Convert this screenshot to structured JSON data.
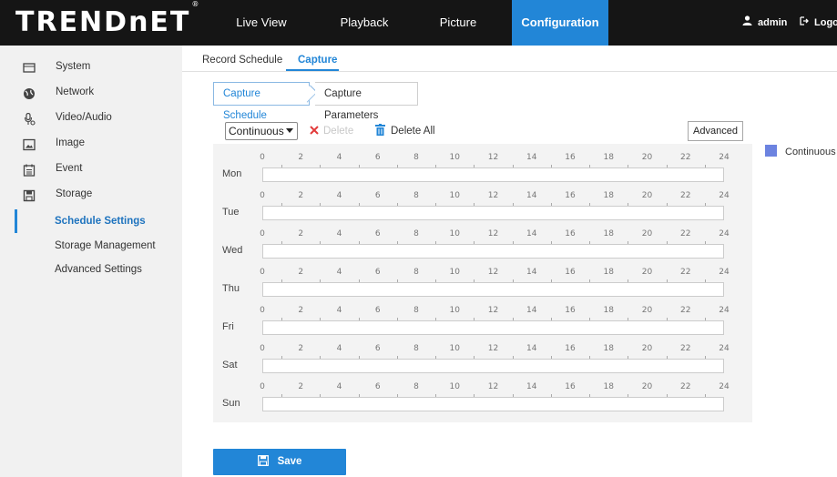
{
  "header": {
    "logo": "TRENDnET",
    "logo_mark": "®",
    "nav": [
      {
        "label": "Live View"
      },
      {
        "label": "Playback"
      },
      {
        "label": "Picture"
      },
      {
        "label": "Configuration",
        "active": true
      }
    ],
    "user_label": "admin",
    "logout_label": "Logout"
  },
  "sidebar": {
    "items": [
      {
        "label": "System",
        "icon": "monitor-icon"
      },
      {
        "label": "Network",
        "icon": "globe-icon"
      },
      {
        "label": "Video/Audio",
        "icon": "video-audio-icon"
      },
      {
        "label": "Image",
        "icon": "image-icon"
      },
      {
        "label": "Event",
        "icon": "calendar-icon"
      },
      {
        "label": "Storage",
        "icon": "storage-icon"
      }
    ],
    "sub_items": [
      {
        "label": "Schedule Settings",
        "active": true
      },
      {
        "label": "Storage Management"
      },
      {
        "label": "Advanced Settings"
      }
    ]
  },
  "tabs": [
    {
      "label": "Record Schedule"
    },
    {
      "label": "Capture",
      "active": true
    }
  ],
  "subtabs": [
    {
      "label": "Capture Schedule",
      "active": true
    },
    {
      "label": "Capture Parameters"
    }
  ],
  "toolbar": {
    "mode_select": "Continuous",
    "delete_label": "Delete",
    "delete_all_label": "Delete All",
    "advanced_label": "Advanced"
  },
  "schedule": {
    "hours": [
      "0",
      "2",
      "4",
      "6",
      "8",
      "10",
      "12",
      "14",
      "16",
      "18",
      "20",
      "22",
      "24"
    ],
    "days": [
      "Mon",
      "Tue",
      "Wed",
      "Thu",
      "Fri",
      "Sat",
      "Sun"
    ]
  },
  "legend": {
    "label": "Continuous",
    "color": "#6c83e0"
  },
  "save_label": "Save",
  "colors": {
    "accent": "#2286d7",
    "header_bg": "#151515",
    "sidebar_bg": "#f1f1f1"
  }
}
